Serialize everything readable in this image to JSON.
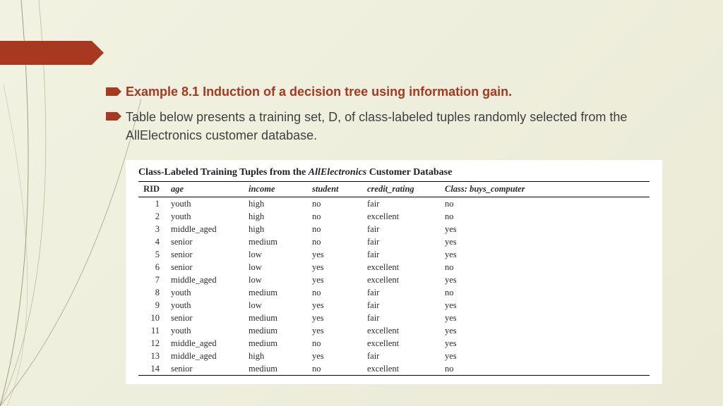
{
  "bullets": {
    "heading": "Example 8.1 Induction of a decision tree using information gain.",
    "body": "Table below presents a training set, D, of class-labeled tuples randomly selected from the AllElectronics customer database."
  },
  "table": {
    "caption_pre": "Class-Labeled Training Tuples from the ",
    "caption_italic": "AllElectronics",
    "caption_post": " Customer Database",
    "headers": {
      "rid": "RID",
      "age": "age",
      "income": "income",
      "student": "student",
      "credit": "credit_rating",
      "class": "Class: buys_computer"
    },
    "rows": [
      {
        "rid": "1",
        "age": "youth",
        "income": "high",
        "student": "no",
        "credit": "fair",
        "class": "no"
      },
      {
        "rid": "2",
        "age": "youth",
        "income": "high",
        "student": "no",
        "credit": "excellent",
        "class": "no"
      },
      {
        "rid": "3",
        "age": "middle_aged",
        "income": "high",
        "student": "no",
        "credit": "fair",
        "class": "yes"
      },
      {
        "rid": "4",
        "age": "senior",
        "income": "medium",
        "student": "no",
        "credit": "fair",
        "class": "yes"
      },
      {
        "rid": "5",
        "age": "senior",
        "income": "low",
        "student": "yes",
        "credit": "fair",
        "class": "yes"
      },
      {
        "rid": "6",
        "age": "senior",
        "income": "low",
        "student": "yes",
        "credit": "excellent",
        "class": "no"
      },
      {
        "rid": "7",
        "age": "middle_aged",
        "income": "low",
        "student": "yes",
        "credit": "excellent",
        "class": "yes"
      },
      {
        "rid": "8",
        "age": "youth",
        "income": "medium",
        "student": "no",
        "credit": "fair",
        "class": "no"
      },
      {
        "rid": "9",
        "age": "youth",
        "income": "low",
        "student": "yes",
        "credit": "fair",
        "class": "yes"
      },
      {
        "rid": "10",
        "age": "senior",
        "income": "medium",
        "student": "yes",
        "credit": "fair",
        "class": "yes"
      },
      {
        "rid": "11",
        "age": "youth",
        "income": "medium",
        "student": "yes",
        "credit": "excellent",
        "class": "yes"
      },
      {
        "rid": "12",
        "age": "middle_aged",
        "income": "medium",
        "student": "no",
        "credit": "excellent",
        "class": "yes"
      },
      {
        "rid": "13",
        "age": "middle_aged",
        "income": "high",
        "student": "yes",
        "credit": "fair",
        "class": "yes"
      },
      {
        "rid": "14",
        "age": "senior",
        "income": "medium",
        "student": "no",
        "credit": "excellent",
        "class": "no"
      }
    ]
  }
}
